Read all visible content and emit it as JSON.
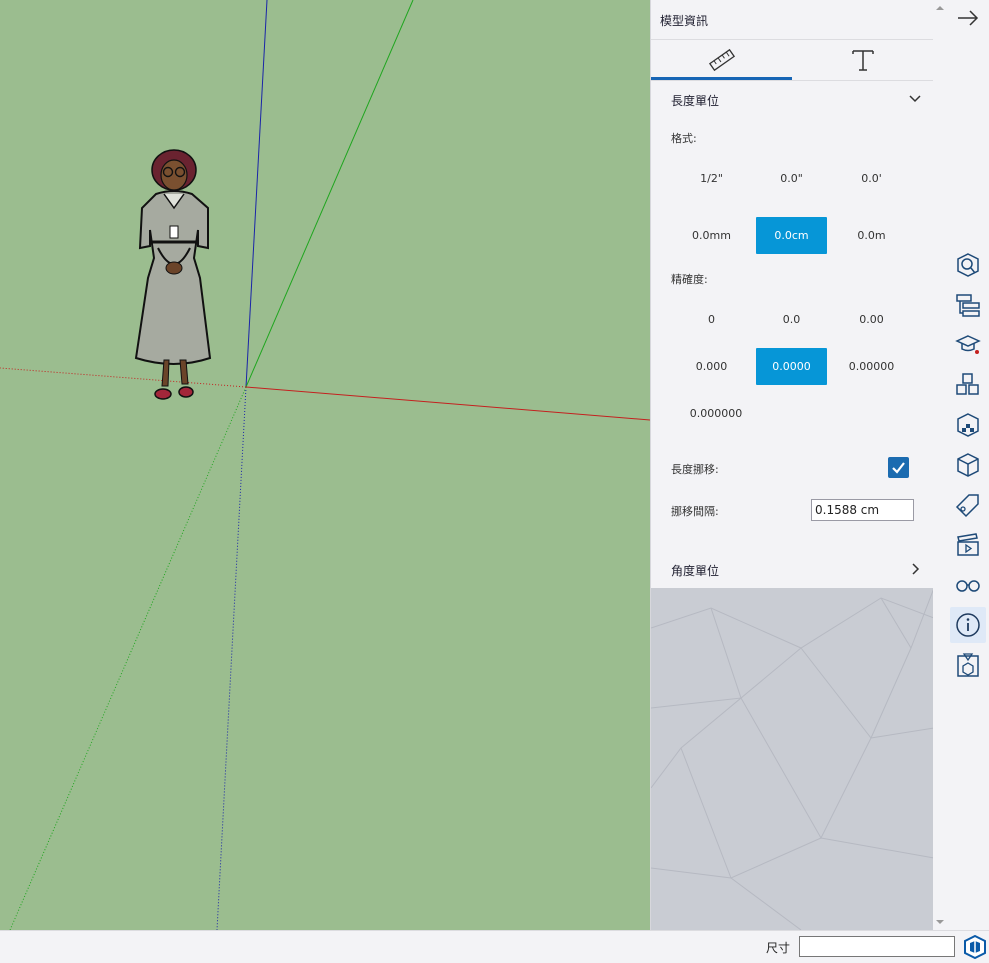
{
  "panel": {
    "title": "模型資訊",
    "tabs": [
      {
        "icon": "ruler-icon",
        "active": true
      },
      {
        "icon": "text-icon",
        "active": false
      }
    ],
    "length_units": {
      "heading": "長度單位",
      "format_label": "格式:",
      "formats": [
        "1/2\"",
        "0.0\"",
        "0.0'",
        "0.0mm",
        "0.0cm",
        "0.0m"
      ],
      "selected_format": "0.0cm",
      "precision_label": "精確度:",
      "precisions": [
        "0",
        "0.0",
        "0.00",
        "0.000",
        "0.0000",
        "0.00000",
        "0.000000"
      ],
      "selected_precision": "0.0000",
      "snapping_label": "長度挪移:",
      "snapping_checked": true,
      "snap_interval_label": "挪移間隔:",
      "snap_interval_value": "0.1588 cm"
    },
    "angle_units": {
      "heading": "角度單位"
    }
  },
  "tray": {
    "collapse_icon": "arrow-right-icon",
    "icons": [
      "search-cube-icon",
      "outliner-icon",
      "instructor-icon",
      "components-icon",
      "materials-icon",
      "styles-icon",
      "tags-icon",
      "scenes-icon",
      "glasses-icon",
      "info-icon",
      "display-icon"
    ],
    "active": "info-icon"
  },
  "statusbar": {
    "measurements_label": "尺寸",
    "measurements_value": ""
  },
  "colors": {
    "viewport": "#9bbd8f",
    "accent": "#0696d7",
    "active_tab": "#1665b5"
  }
}
